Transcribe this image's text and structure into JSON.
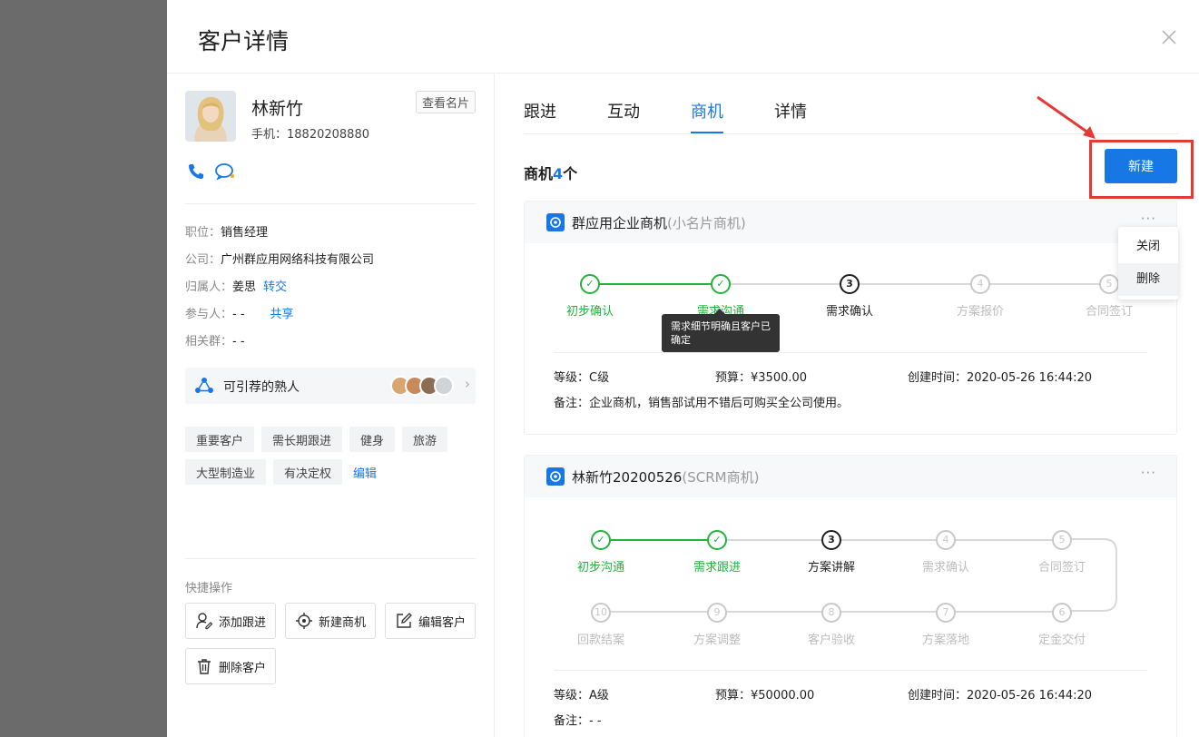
{
  "drawer": {
    "title": "客户详情"
  },
  "customer": {
    "name": "林新竹",
    "phone": "手机：18820208880",
    "card_button": "查看名片",
    "info": [
      {
        "label": "职位：",
        "value": "销售经理"
      },
      {
        "label": "公司：",
        "value": "广州群应用网络科技有限公司"
      },
      {
        "label": "归属人：",
        "value": "姜思",
        "link": "转交"
      },
      {
        "label": "参与人：",
        "value": "- -",
        "link": "共享"
      },
      {
        "label": "相关群：",
        "value": "- -"
      }
    ],
    "acquaintance_label": "可引荐的熟人",
    "tags": [
      "重要客户",
      "需长期跟进",
      "健身",
      "旅游",
      "大型制造业",
      "有决定权"
    ],
    "tags_edit": "编辑",
    "quick_title": "快捷操作",
    "quick_actions": [
      "添加跟进",
      "新建商机",
      "编辑客户",
      "删除客户"
    ]
  },
  "tabs": [
    "跟进",
    "互动",
    "商机",
    "详情"
  ],
  "active_tab": 2,
  "opportunities": {
    "count_prefix": "商机",
    "count_value": "4",
    "count_suffix": "个",
    "new_button": "新建",
    "cards": [
      {
        "name": "群应用企业商机",
        "type": "(小名片商机)",
        "more": "···",
        "steps": [
          {
            "num": "✓",
            "label": "初步确认",
            "state": "done"
          },
          {
            "num": "✓",
            "label": "需求沟通",
            "state": "done"
          },
          {
            "num": "3",
            "label": "需求确认",
            "state": "current"
          },
          {
            "num": "4",
            "label": "方案报价",
            "state": "todo"
          },
          {
            "num": "5",
            "label": "合同签订",
            "state": "todo"
          }
        ],
        "tooltip": "需求细节明确且客户已确定",
        "grade": "等级：C级",
        "budget": "预算：¥3500.00",
        "created": "创建时间：2020-05-26 16:44:20",
        "note": "备注：企业商机，销售部试用不错后可购买全公司使用。",
        "menu": [
          "关闭",
          "删除"
        ]
      },
      {
        "name": "林新竹20200526",
        "type": "(SCRM商机)",
        "more": "···",
        "steps": [
          {
            "num": "✓",
            "label": "初步沟通",
            "state": "done"
          },
          {
            "num": "✓",
            "label": "需求跟进",
            "state": "done"
          },
          {
            "num": "3",
            "label": "方案讲解",
            "state": "current"
          },
          {
            "num": "4",
            "label": "需求确认",
            "state": "todo"
          },
          {
            "num": "5",
            "label": "合同签订",
            "state": "todo"
          },
          {
            "num": "6",
            "label": "定金交付",
            "state": "todo"
          },
          {
            "num": "7",
            "label": "方案落地",
            "state": "todo"
          },
          {
            "num": "8",
            "label": "客户验收",
            "state": "todo"
          },
          {
            "num": "9",
            "label": "方案调整",
            "state": "todo"
          },
          {
            "num": "10",
            "label": "回款结案",
            "state": "todo"
          }
        ],
        "grade": "等级：A级",
        "budget": "预算：¥50000.00",
        "created": "创建时间：2020-05-26 16:44:20",
        "note": "备注：- -"
      }
    ]
  },
  "colors": {
    "accent": "#1677e5",
    "done": "#22b43c",
    "highlight": "#e53935"
  }
}
